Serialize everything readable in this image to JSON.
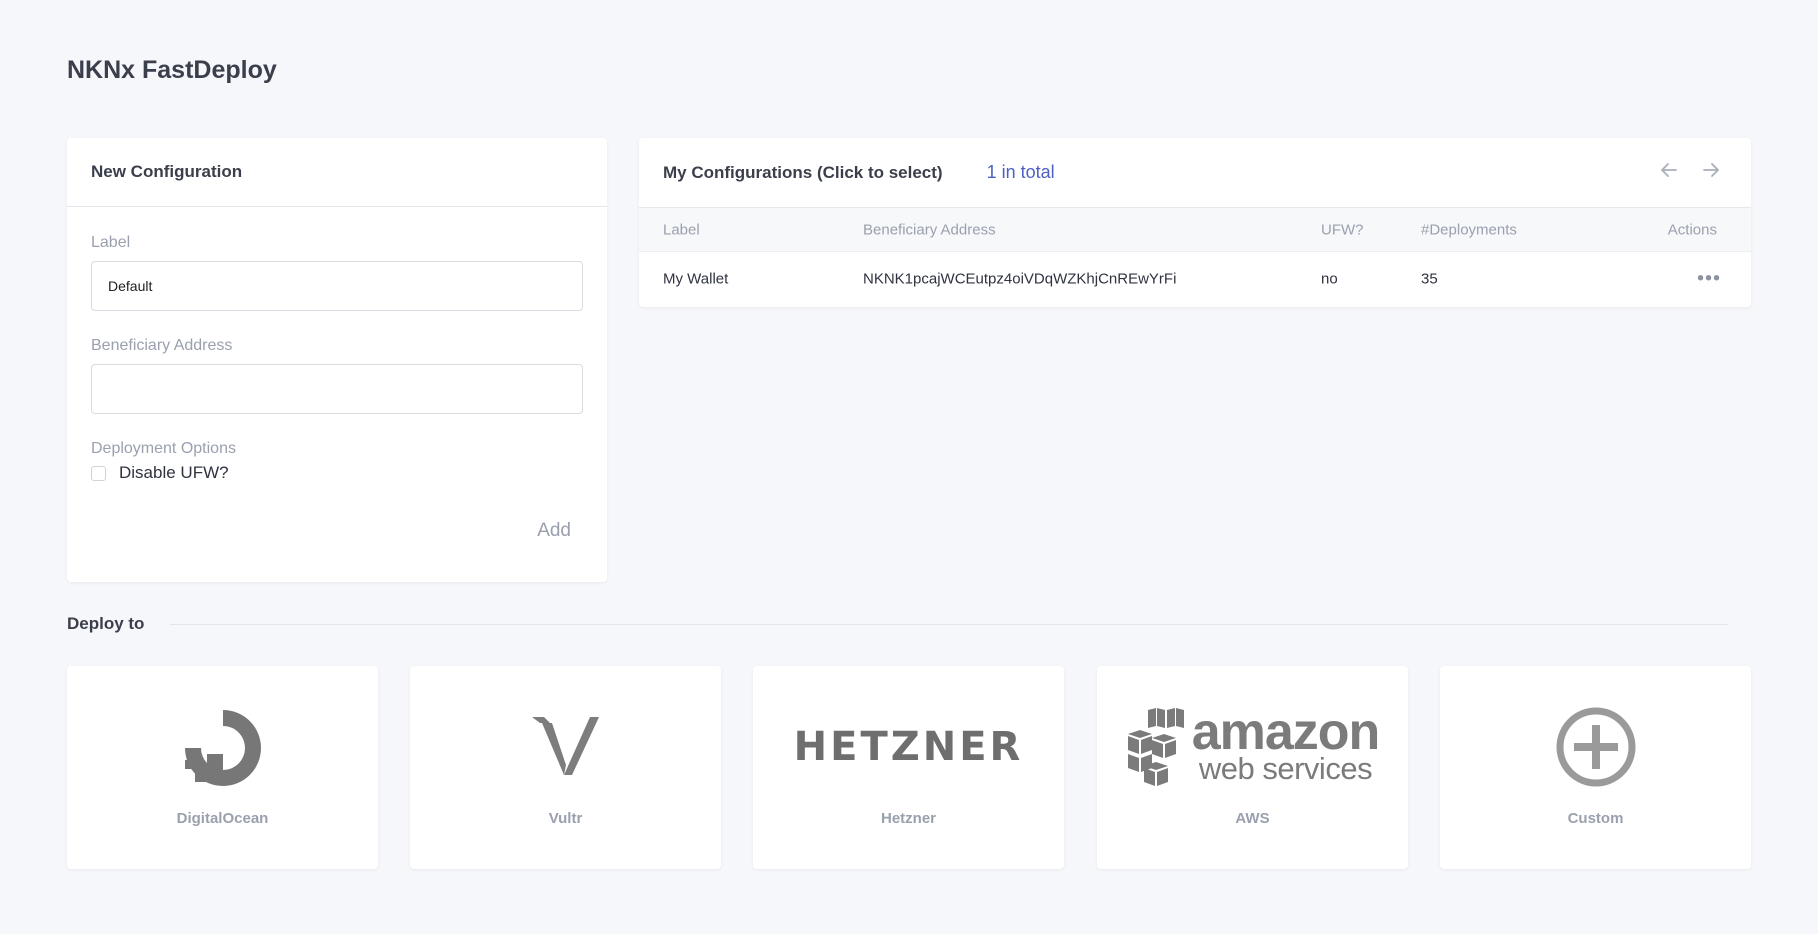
{
  "app": {
    "title": "NKNx FastDeploy"
  },
  "new_config": {
    "title": "New Configuration",
    "label_field": {
      "label": "Label",
      "value": "Default",
      "placeholder": ""
    },
    "address_field": {
      "label": "Beneficiary Address",
      "value": "",
      "placeholder": ""
    },
    "options_label": "Deployment Options",
    "disable_ufw_label": "Disable UFW?",
    "disable_ufw_checked": false,
    "add_label": "Add"
  },
  "my_configs": {
    "title": "My Configurations (Click to select)",
    "total": "1 in total",
    "prev_icon": "arrow-left-icon",
    "next_icon": "arrow-right-icon",
    "columns": [
      "Label",
      "Beneficiary Address",
      "UFW?",
      "#Deployments",
      "Actions"
    ],
    "rows": [
      {
        "label": "My Wallet",
        "address": "NKNK1pcajWCEutpz4oiVDqWZKhjCnREwYrFi",
        "ufw": "no",
        "deployments": "35",
        "actions": "•••"
      }
    ]
  },
  "deploy": {
    "title": "Deploy to",
    "providers": [
      {
        "name": "DigitalOcean",
        "icon": "digitalocean-logo"
      },
      {
        "name": "Vultr",
        "icon": "vultr-logo"
      },
      {
        "name": "Hetzner",
        "icon": "hetzner-logo",
        "logo_text": "HETZNER"
      },
      {
        "name": "AWS",
        "icon": "aws-logo",
        "logo_text": "amazon",
        "logo_subtext": "web services"
      },
      {
        "name": "Custom",
        "icon": "plus-circle-icon"
      }
    ]
  },
  "colors": {
    "background": "#f6f7fa",
    "accent": "#4e5fc4",
    "muted_text": "#9aa0ae",
    "logo_gray": "#7b7b7b"
  }
}
